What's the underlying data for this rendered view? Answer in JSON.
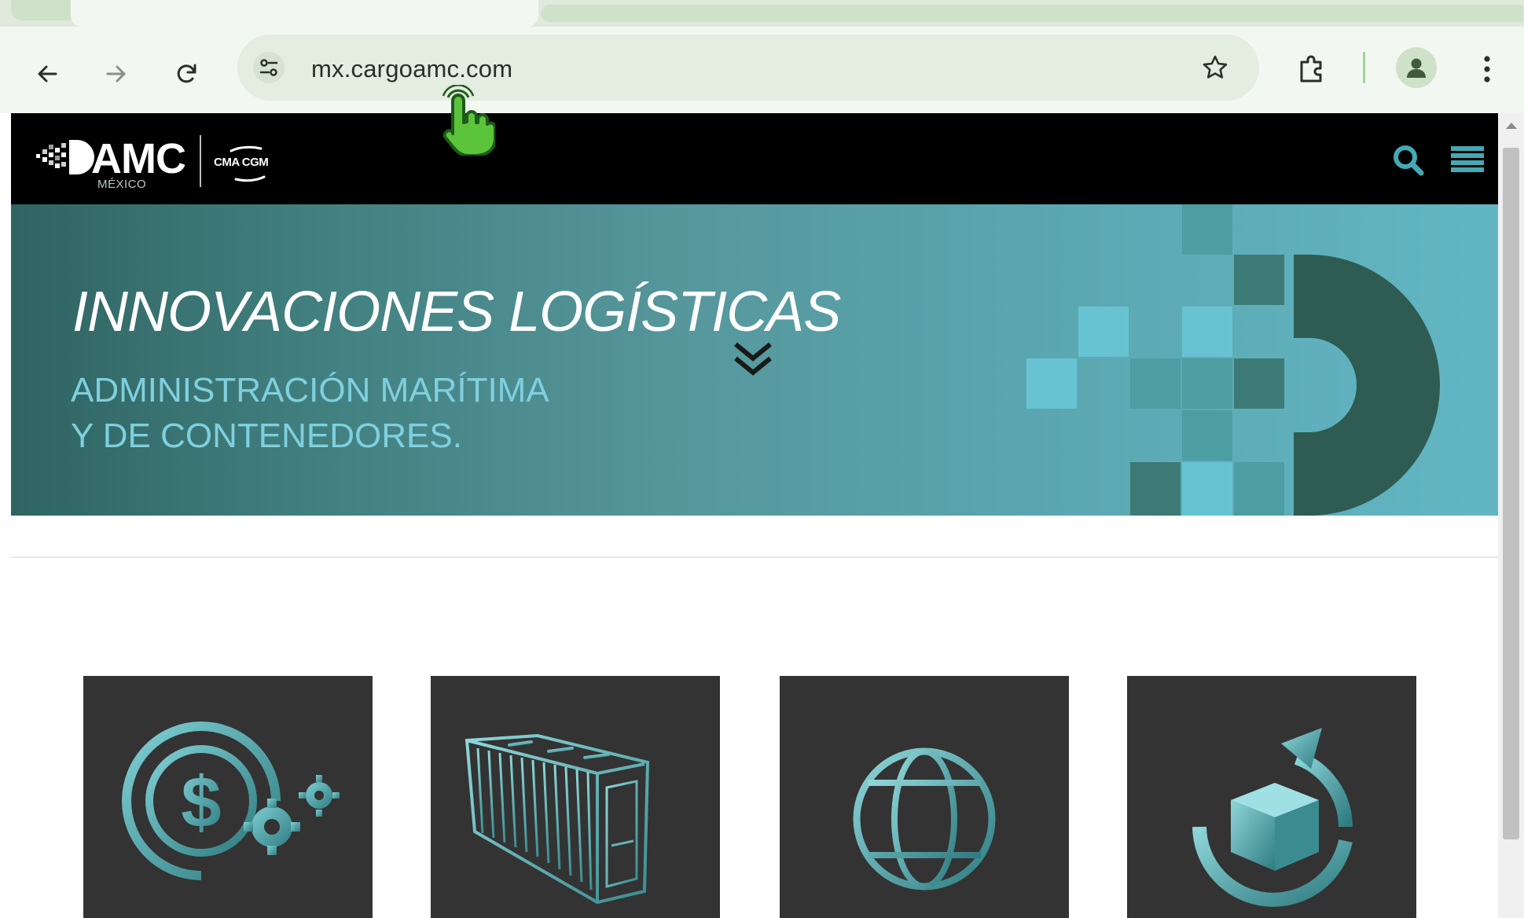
{
  "browser": {
    "url": "mx.cargoamc.com",
    "icons": {
      "back": "arrow-left-icon",
      "forward": "arrow-right-icon",
      "reload": "reload-icon",
      "site_info": "tune-icon",
      "bookmark": "star-icon",
      "extensions": "puzzle-icon",
      "profile": "person-icon",
      "menu": "kebab-icon"
    },
    "colors": {
      "toolbar": "#f3f7f1",
      "omnibox": "#e3ede0",
      "accent": "#9bd39a"
    }
  },
  "site": {
    "logo_text": "AMC",
    "logo_sub": "MÉXICO",
    "partner_logo": "CMA CGM",
    "header_icons": [
      "search-icon",
      "menu-icon"
    ],
    "colors": {
      "header": "#000000",
      "accent": "#43aab4"
    }
  },
  "hero": {
    "title": "INNOVACIONES LOGÍSTICAS",
    "subtitle_line1": "ADMINISTRACIÓN MARÍTIMA",
    "subtitle_line2": "Y DE CONTENEDORES.",
    "scroll_icon": "double-chevron-down-icon",
    "colors": {
      "from": "#2f6462",
      "to": "#62b6c3",
      "subtitle": "#7fd0de"
    }
  },
  "services": {
    "cards": [
      {
        "icon": "dollar-gear-icon"
      },
      {
        "icon": "shipping-container-icon"
      },
      {
        "icon": "globe-icon"
      },
      {
        "icon": "box-cycle-icon"
      }
    ],
    "colors": {
      "card_bg": "#333333",
      "icon": "#5ab2b8"
    }
  },
  "cursor": {
    "type": "hand-pointer-icon",
    "color": "#4caf2e"
  }
}
